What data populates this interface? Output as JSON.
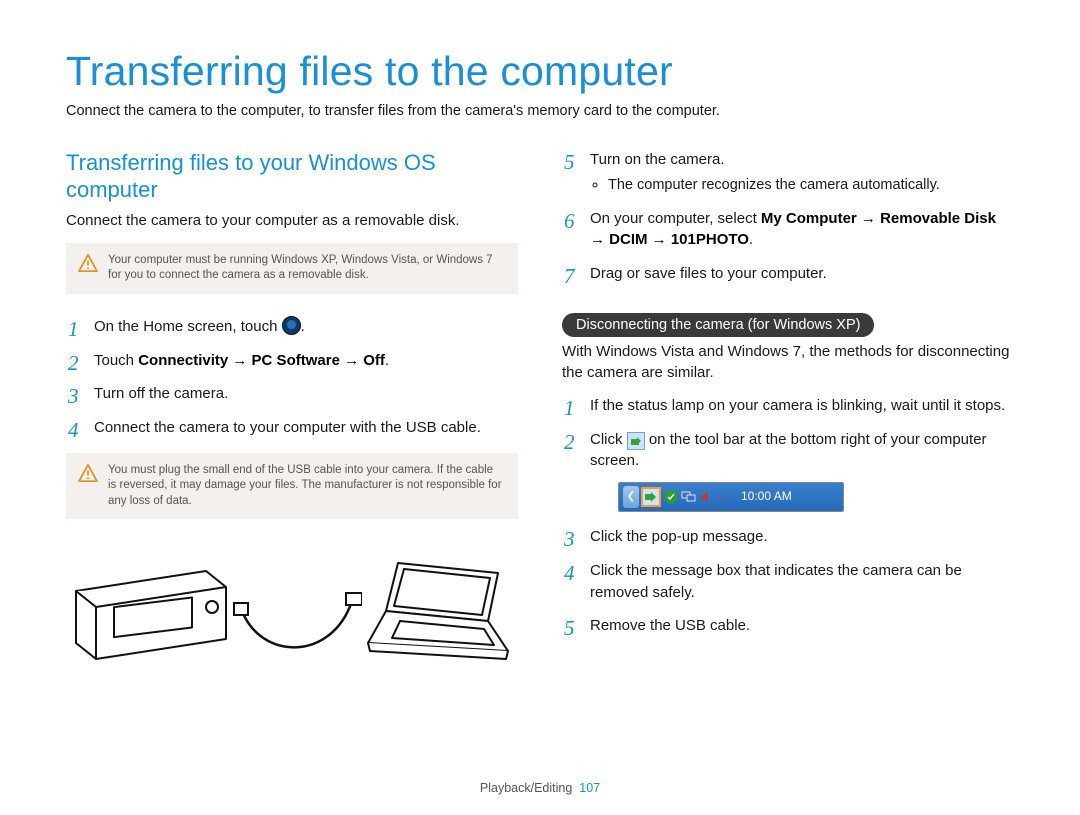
{
  "title": "Transferring files to the computer",
  "intro": "Connect the camera to the computer, to transfer files from the camera's memory card to the computer.",
  "left": {
    "subtitle": "Transferring files to your Windows OS computer",
    "para": "Connect the camera to your computer as a removable disk.",
    "note1": "Your computer must be running Windows XP, Windows Vista, or Windows 7 for you to connect the camera as a removable disk.",
    "steps": {
      "s1_a": "On the Home screen, touch ",
      "s1_b": ".",
      "s2_a": "Touch ",
      "s2_b": "Connectivity → PC Software → Off",
      "s2_c": ".",
      "s3": "Turn off the camera.",
      "s4": "Connect the camera to your computer with the USB cable."
    },
    "note2": "You must plug the small end of the USB cable into your camera. If the cable is reversed, it may damage your files. The manufacturer is not responsible for any loss of data."
  },
  "right": {
    "steps": {
      "s5": "Turn on the camera.",
      "s5_sub": "The computer recognizes the camera automatically.",
      "s6_a": "On your computer, select ",
      "s6_b": "My Computer → Removable Disk → DCIM → 101PHOTO",
      "s6_c": ".",
      "s7": "Drag or save files to your computer."
    },
    "pill": "Disconnecting the camera (for Windows XP)",
    "pill_para": "With Windows Vista and Windows 7, the methods for disconnecting the camera are similar.",
    "dsteps": {
      "d1": "If the status lamp on your camera is blinking, wait until it stops.",
      "d2_a": "Click ",
      "d2_b": " on the tool bar at the bottom right of your computer screen.",
      "d3": "Click the pop-up message.",
      "d4": "Click the message box that indicates the camera can be removed safely.",
      "d5": "Remove the USB cable."
    },
    "tray_time": "10:00 AM"
  },
  "footer": {
    "section": "Playback/Editing",
    "page": "107"
  }
}
